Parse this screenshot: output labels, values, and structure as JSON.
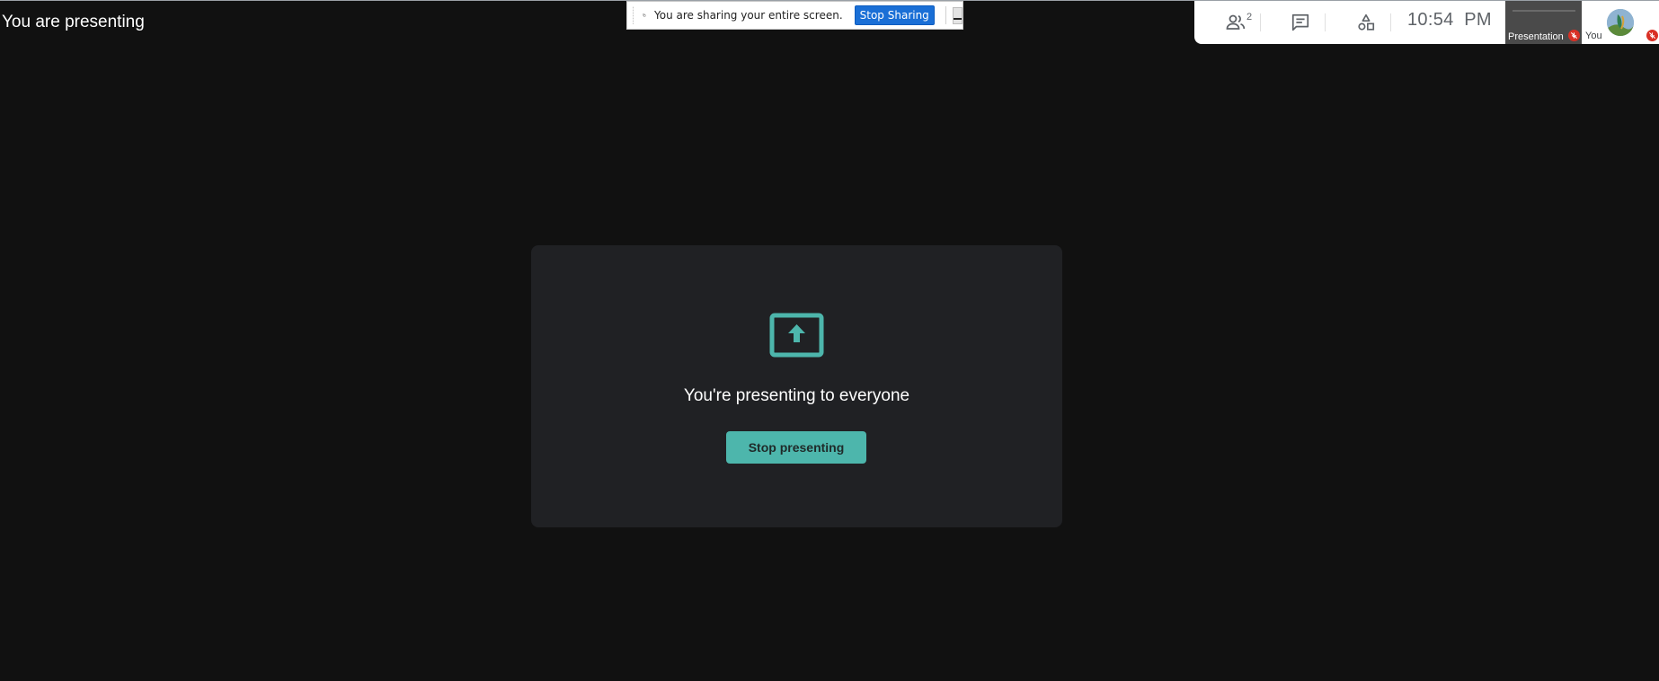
{
  "header": {
    "presenting_text": "You are presenting"
  },
  "share_bar": {
    "message": "You are sharing your entire screen.",
    "stop_label": "Stop Sharing"
  },
  "toolbar": {
    "people_count": "2",
    "time": "10:54  PM",
    "icons": [
      "people-icon",
      "chat-icon",
      "activities-icon"
    ]
  },
  "tiles": {
    "presentation_label": "Presentation",
    "you_label": "You"
  },
  "card": {
    "title": "You're presenting to everyone",
    "button_label": "Stop presenting",
    "accent_color": "#4db6ac"
  }
}
